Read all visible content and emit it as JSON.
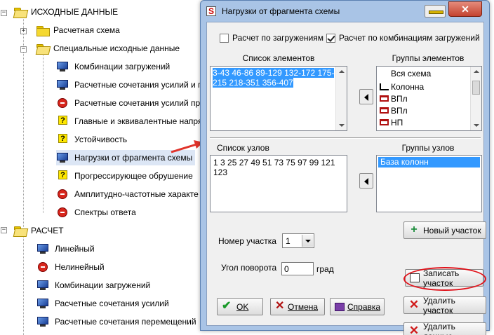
{
  "tree": {
    "items": [
      {
        "label": "ИСХОДНЫЕ ДАННЫЕ",
        "icon": "folder-open-icon"
      },
      {
        "label": "Расчетная схема",
        "icon": "folder-icon"
      },
      {
        "label": "Специальные исходные данные",
        "icon": "folder-open-icon"
      },
      {
        "label": "Комбинации загружений",
        "icon": "monitor-icon"
      },
      {
        "label": "Расчетные сочетания усилий и п",
        "icon": "monitor-icon"
      },
      {
        "label": "Расчетные сочетания усилий пр",
        "icon": "stop-icon"
      },
      {
        "label": "Главные и эквивалентные напря",
        "icon": "question-icon"
      },
      {
        "label": "Устойчивость",
        "icon": "question-icon"
      },
      {
        "label": "Нагрузки от фрагмента схемы",
        "icon": "monitor-icon"
      },
      {
        "label": "Прогрессирующее обрушение",
        "icon": "question-icon"
      },
      {
        "label": "Амплитудно-частотные характе",
        "icon": "stop-icon"
      },
      {
        "label": "Спектры ответа",
        "icon": "stop-icon"
      },
      {
        "label": "РАСЧЕТ",
        "icon": "folder-open-icon"
      },
      {
        "label": "Линейный",
        "icon": "monitor-icon"
      },
      {
        "label": "Нелинейный",
        "icon": "stop-icon"
      },
      {
        "label": "Комбинации загружений",
        "icon": "monitor-icon"
      },
      {
        "label": "Расчетные сочетания усилий",
        "icon": "monitor-icon"
      },
      {
        "label": "Расчетные сочетания перемещений",
        "icon": "monitor-icon"
      }
    ]
  },
  "dialog": {
    "title": "Нагрузки от фрагмента схемы",
    "close_label": "✕",
    "check_loads": "Расчет по загружениям",
    "check_load_combos": "Расчет по комбинациям загружений",
    "check_loads_checked": false,
    "check_load_combos_checked": true,
    "elements_caption": "Список элементов",
    "elements_text": "3-43 46-86 89-129 132-172 175-215 218-351 356-407",
    "element_groups_caption": "Группы элементов",
    "element_groups": [
      "Вся схема",
      "Колонна",
      "ВПл",
      "ВПл",
      "НП"
    ],
    "nodes_caption": "Список узлов",
    "nodes_text": "1 3 25 27 49 51 73 75 97 99 121 123",
    "node_groups_caption": "Группы узлов",
    "node_groups": [
      "База колонн"
    ],
    "section_number_label": "Номер участка",
    "section_number_value": "1",
    "angle_label": "Угол поворота",
    "angle_value": "0",
    "angle_unit": "град",
    "buttons": {
      "new_section": "Новый участок",
      "save_section": "Записать участок",
      "delete_section": "Удалить участок",
      "delete_data": "Удалить данные",
      "ok": "OK",
      "cancel": "Отмена",
      "help": "Справка"
    }
  }
}
